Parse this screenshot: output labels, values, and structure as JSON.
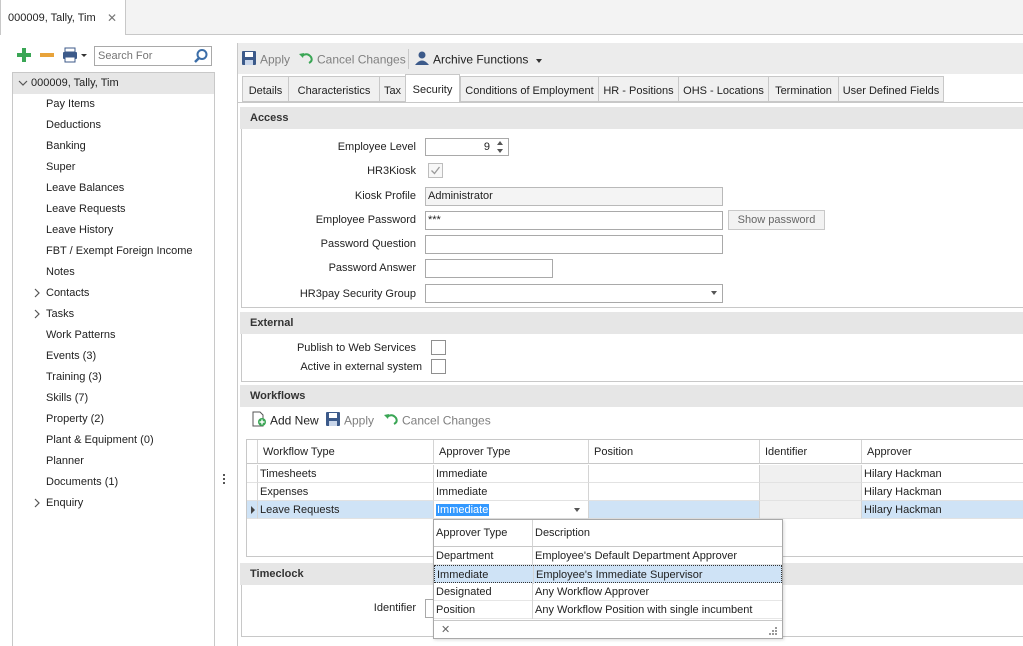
{
  "doc_tab": {
    "title": "000009, Tally, Tim",
    "close": "✕"
  },
  "left": {
    "search_placeholder": "Search For",
    "tree": {
      "root": "000009, Tally, Tim",
      "items": [
        {
          "label": "Pay Items"
        },
        {
          "label": "Deductions"
        },
        {
          "label": "Banking"
        },
        {
          "label": "Super"
        },
        {
          "label": "Leave Balances"
        },
        {
          "label": "Leave Requests"
        },
        {
          "label": "Leave History"
        },
        {
          "label": "FBT / Exempt Foreign Income"
        },
        {
          "label": "Notes"
        },
        {
          "label": "Contacts",
          "expandable": true
        },
        {
          "label": "Tasks",
          "expandable": true
        },
        {
          "label": "Work Patterns"
        },
        {
          "label": "Events (3)"
        },
        {
          "label": "Training (3)"
        },
        {
          "label": "Skills (7)"
        },
        {
          "label": "Property (2)"
        },
        {
          "label": "Plant & Equipment (0)"
        },
        {
          "label": "Planner"
        },
        {
          "label": "Documents (1)"
        },
        {
          "label": "Enquiry",
          "expandable": true
        }
      ]
    }
  },
  "toolbar": {
    "apply": "Apply",
    "cancel_changes": "Cancel Changes",
    "archive_functions": "Archive Functions"
  },
  "tabs": [
    {
      "label": "Details"
    },
    {
      "label": "Characteristics"
    },
    {
      "label": "Tax"
    },
    {
      "label": "Security",
      "active": true
    },
    {
      "label": "Conditions of Employment"
    },
    {
      "label": "HR - Positions"
    },
    {
      "label": "OHS - Locations"
    },
    {
      "label": "Termination"
    },
    {
      "label": "User Defined Fields"
    }
  ],
  "access": {
    "header": "Access",
    "employee_level_label": "Employee Level",
    "employee_level_value": "9",
    "hr3kiosk_label": "HR3Kiosk",
    "hr3kiosk_checked": true,
    "kiosk_profile_label": "Kiosk Profile",
    "kiosk_profile_value": "Administrator",
    "employee_password_label": "Employee Password",
    "employee_password_value": "***",
    "show_password": "Show password",
    "password_question_label": "Password Question",
    "password_question_value": "",
    "password_answer_label": "Password Answer",
    "password_answer_value": "",
    "security_group_label": "HR3pay Security Group",
    "security_group_value": ""
  },
  "external": {
    "header": "External",
    "publish_label": "Publish to Web Services",
    "publish_checked": false,
    "active_label": "Active in external system",
    "active_checked": false
  },
  "workflows": {
    "header": "Workflows",
    "add_new": "Add New",
    "apply": "Apply",
    "cancel_changes": "Cancel Changes",
    "columns": [
      "Workflow Type",
      "Approver Type",
      "Position",
      "Identifier",
      "Approver"
    ],
    "rows": [
      {
        "workflow_type": "Timesheets",
        "approver_type": "Immediate",
        "position": "",
        "identifier": "",
        "approver": "Hilary Hackman"
      },
      {
        "workflow_type": "Expenses",
        "approver_type": "Immediate",
        "position": "",
        "identifier": "",
        "approver": "Hilary Hackman"
      },
      {
        "workflow_type": "Leave Requests",
        "approver_type": "Immediate",
        "position": "",
        "identifier": "",
        "approver": "Hilary Hackman"
      }
    ]
  },
  "approver_popup": {
    "columns": [
      "Approver Type",
      "Description"
    ],
    "options": [
      {
        "type": "Department",
        "description": "Employee's Default Department Approver"
      },
      {
        "type": "Immediate",
        "description": "Employee's Immediate Supervisor",
        "selected": true
      },
      {
        "type": "Designated",
        "description": "Any Workflow Approver"
      },
      {
        "type": "Position",
        "description": "Any Workflow Position with single incumbent"
      }
    ],
    "clear": "✕"
  },
  "timeclock": {
    "header": "Timeclock",
    "identifier_label": "Identifier"
  },
  "colors": {
    "accent_green": "#3aa655",
    "accent_orange": "#e8a33a",
    "selection": "#cfe3f6",
    "edit_highlight": "#3399ff"
  }
}
